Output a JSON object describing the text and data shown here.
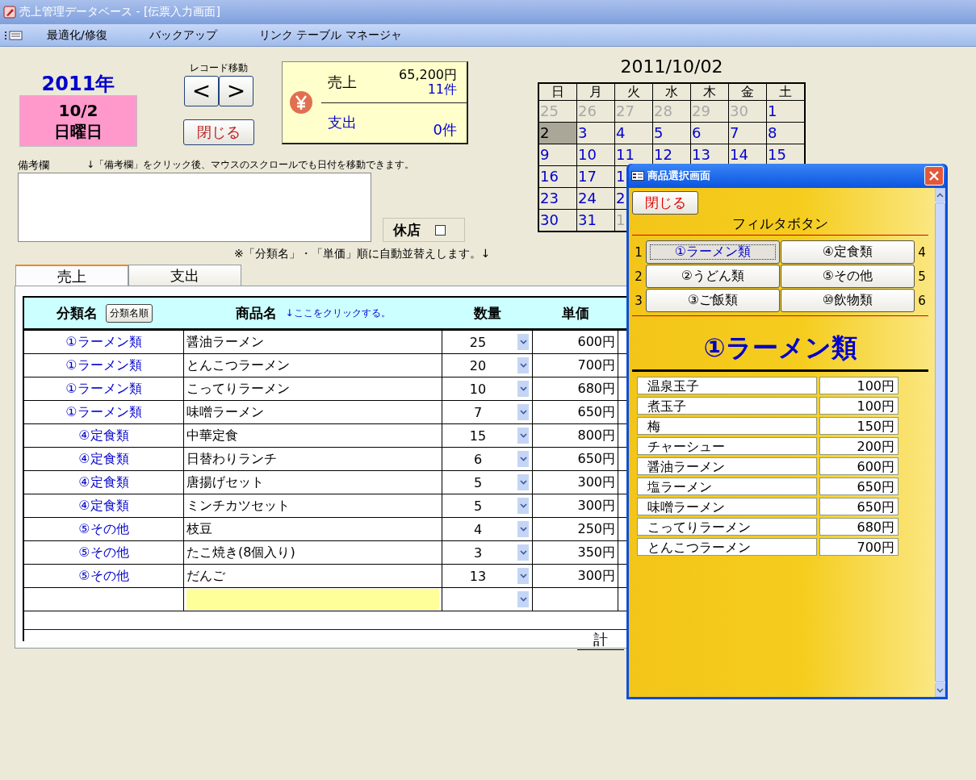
{
  "window": {
    "title": "売上管理データベース - [伝票入力画面]"
  },
  "menu": [
    "最適化/修復",
    "バックアップ",
    "リンク テーブル マネージャ"
  ],
  "date_panel": {
    "year": "2011年",
    "date": "10/2",
    "weekday": "日曜日"
  },
  "record_nav": {
    "label": "レコード移動",
    "prev": "<",
    "next": ">",
    "close": "閉じる"
  },
  "summary": {
    "sales_label": "売上",
    "sales_amount": "65,200円",
    "sales_count": "11件",
    "expense_label": "支出",
    "expense_count": "0件"
  },
  "calendar": {
    "title": "2011/10/02",
    "weekdays": [
      "日",
      "月",
      "火",
      "水",
      "木",
      "金",
      "土"
    ],
    "weeks": [
      [
        {
          "day": "25",
          "kind": "other",
          "selected": false
        },
        {
          "day": "26",
          "kind": "other",
          "selected": false
        },
        {
          "day": "27",
          "kind": "other",
          "selected": false
        },
        {
          "day": "28",
          "kind": "other",
          "selected": false
        },
        {
          "day": "29",
          "kind": "other",
          "selected": false
        },
        {
          "day": "30",
          "kind": "other",
          "selected": false
        },
        {
          "day": "1",
          "kind": "current",
          "selected": false
        }
      ],
      [
        {
          "day": "2",
          "kind": "current",
          "selected": true
        },
        {
          "day": "3",
          "kind": "current",
          "selected": false
        },
        {
          "day": "4",
          "kind": "current",
          "selected": false
        },
        {
          "day": "5",
          "kind": "current",
          "selected": false
        },
        {
          "day": "6",
          "kind": "current",
          "selected": false
        },
        {
          "day": "7",
          "kind": "current",
          "selected": false
        },
        {
          "day": "8",
          "kind": "current",
          "selected": false
        }
      ],
      [
        {
          "day": "9",
          "kind": "current",
          "selected": false
        },
        {
          "day": "10",
          "kind": "current",
          "selected": false
        },
        {
          "day": "11",
          "kind": "current",
          "selected": false
        },
        {
          "day": "12",
          "kind": "current",
          "selected": false
        },
        {
          "day": "13",
          "kind": "current",
          "selected": false
        },
        {
          "day": "14",
          "kind": "current",
          "selected": false
        },
        {
          "day": "15",
          "kind": "current",
          "selected": false
        }
      ],
      [
        {
          "day": "16",
          "kind": "current",
          "selected": false
        },
        {
          "day": "17",
          "kind": "current",
          "selected": false
        },
        {
          "day": "1",
          "kind": "current",
          "selected": false
        }
      ],
      [
        {
          "day": "23",
          "kind": "current",
          "selected": false
        },
        {
          "day": "24",
          "kind": "current",
          "selected": false
        },
        {
          "day": "2",
          "kind": "current",
          "selected": false
        }
      ],
      [
        {
          "day": "30",
          "kind": "current",
          "selected": false
        },
        {
          "day": "31",
          "kind": "current",
          "selected": false
        },
        {
          "day": "1",
          "kind": "other",
          "selected": false
        }
      ]
    ]
  },
  "remarks": {
    "label": "備考欄",
    "hint": "↓「備考欄」をクリック後、マウスのスクロールでも日付を移動できます。"
  },
  "closed": {
    "label": "休店",
    "checked": false
  },
  "sort_note": "※「分類名」・「単価」順に自動並替えします。↓",
  "tabs": [
    {
      "label": "売上",
      "selected": true
    },
    {
      "label": "支出",
      "selected": false
    }
  ],
  "table": {
    "columns": [
      "分類名",
      "商品名",
      "数量",
      "単価"
    ],
    "sort_button": "分類名順",
    "hint": "↓ここをクリックする。",
    "rows": [
      {
        "category": "①ラーメン類",
        "product": "醤油ラーメン",
        "qty": "25",
        "price": "600円"
      },
      {
        "category": "①ラーメン類",
        "product": "とんこつラーメン",
        "qty": "20",
        "price": "700円"
      },
      {
        "category": "①ラーメン類",
        "product": "こってりラーメン",
        "qty": "10",
        "price": "680円"
      },
      {
        "category": "①ラーメン類",
        "product": "味噌ラーメン",
        "qty": "7",
        "price": "650円"
      },
      {
        "category": "④定食類",
        "product": "中華定食",
        "qty": "15",
        "price": "800円"
      },
      {
        "category": "④定食類",
        "product": "日替わりランチ",
        "qty": "6",
        "price": "650円"
      },
      {
        "category": "④定食類",
        "product": "唐揚げセット",
        "qty": "5",
        "price": "300円"
      },
      {
        "category": "④定食類",
        "product": "ミンチカツセット",
        "qty": "5",
        "price": "300円"
      },
      {
        "category": "⑤その他",
        "product": "枝豆",
        "qty": "4",
        "price": "250円"
      },
      {
        "category": "⑤その他",
        "product": "たこ焼き(8個入り)",
        "qty": "3",
        "price": "350円"
      },
      {
        "category": "⑤その他",
        "product": "だんご",
        "qty": "13",
        "price": "300円"
      }
    ],
    "total_label": "計"
  },
  "popup": {
    "title": "商品選択画面",
    "close": "閉じる",
    "filter_label": "フィルタボタン",
    "filter_rows": [
      {
        "left": {
          "number": "1",
          "label": "①ラーメン類",
          "selected": true
        },
        "right": {
          "number": "4",
          "label": "④定食類",
          "selected": false
        }
      },
      {
        "left": {
          "number": "2",
          "label": "②うどん類",
          "selected": false
        },
        "right": {
          "number": "5",
          "label": "⑤その他",
          "selected": false
        }
      },
      {
        "left": {
          "number": "3",
          "label": "③ご飯類",
          "selected": false
        },
        "right": {
          "number": "6",
          "label": "⑩飲物類",
          "selected": false
        }
      }
    ],
    "heading": "①ラーメン類",
    "products": [
      {
        "name": "温泉玉子",
        "price": "100円"
      },
      {
        "name": "煮玉子",
        "price": "100円"
      },
      {
        "name": "梅",
        "price": "150円"
      },
      {
        "name": "チャーシュー",
        "price": "200円"
      },
      {
        "name": "醤油ラーメン",
        "price": "600円"
      },
      {
        "name": "塩ラーメン",
        "price": "650円"
      },
      {
        "name": "味噌ラーメン",
        "price": "650円"
      },
      {
        "name": "こってりラーメン",
        "price": "680円"
      },
      {
        "name": "とんこつラーメン",
        "price": "700円"
      }
    ]
  }
}
